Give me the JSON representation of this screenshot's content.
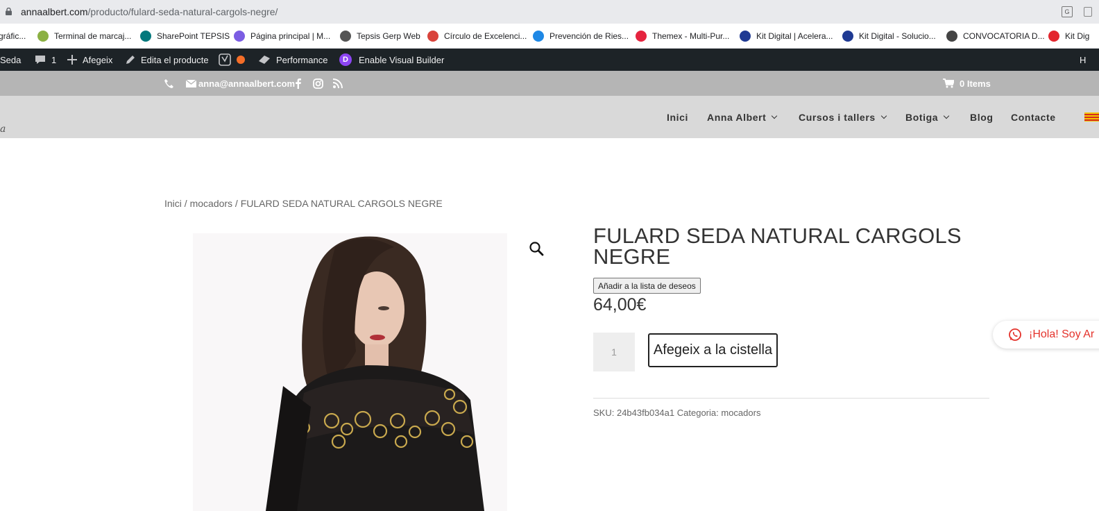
{
  "browser": {
    "url_domain": "annaalbert.com",
    "url_path": "/producto/fulard-seda-natural-cargols-negre/"
  },
  "bookmarks": [
    {
      "label": "gráfic...",
      "color": "#5b8a3a",
      "icon": "bookmark-icon"
    },
    {
      "label": "Terminal de marcaj...",
      "color": "#8bb043",
      "icon": "clock-globe-icon"
    },
    {
      "label": "SharePoint TEPSIS",
      "color": "#03787c",
      "icon": "sharepoint-icon"
    },
    {
      "label": "Página principal | M...",
      "color": "#7b5de3",
      "icon": "microsoft-icon"
    },
    {
      "label": "Tepsis Gerp Web",
      "color": "#555555",
      "icon": "globe-icon"
    },
    {
      "label": "Círculo de Excelenci...",
      "color": "#d9433b",
      "icon": "circle-logo-icon"
    },
    {
      "label": "Prevención de Ries...",
      "color": "#1e88e5",
      "icon": "arc-logo-icon"
    },
    {
      "label": "Themex - Multi-Pur...",
      "color": "#e5243f",
      "icon": "themex-icon"
    },
    {
      "label": "Kit Digital | Acelera...",
      "color": "#1f3a93",
      "icon": "kit-digital-icon"
    },
    {
      "label": "Kit Digital - Solucio...",
      "color": "#1f3a93",
      "icon": "kit-digital-icon"
    },
    {
      "label": "CONVOCATORIA D...",
      "color": "#444444",
      "icon": "text-logo-icon"
    },
    {
      "label": "Kit Dig",
      "color": "#e3262e",
      "icon": "kd-logo-icon"
    }
  ],
  "adminbar": {
    "site_name": "Seda",
    "comments_count": "1",
    "new_label": "Afegeix",
    "edit_label": "Edita el producte",
    "performance_label": "Performance",
    "visual_builder_label": "Enable Visual Builder",
    "divi_letter": "D",
    "right_fragment": "H"
  },
  "topbar": {
    "email": "anna@annaalbert.com",
    "cart_label": "0 Items"
  },
  "nav": {
    "items": [
      {
        "label": "Inici",
        "dropdown": false
      },
      {
        "label": "Anna Albert",
        "dropdown": true
      },
      {
        "label": "Cursos i tallers",
        "dropdown": true
      },
      {
        "label": "Botiga",
        "dropdown": true
      },
      {
        "label": "Blog",
        "dropdown": false
      },
      {
        "label": "Contacte",
        "dropdown": false
      }
    ],
    "logo_fragment": "a"
  },
  "breadcrumb": {
    "home": "Inici",
    "sep1": " / ",
    "category": "mocadors",
    "sep2": " / ",
    "current": "FULARD SEDA NATURAL CARGOLS NEGRE"
  },
  "product": {
    "title": "FULARD SEDA NATURAL CARGOLS NEGRE",
    "wishlist_label": "Añadir a la lista de deseos",
    "price": "64,00€",
    "quantity": "1",
    "add_to_cart_label": "Afegeix a la cistella",
    "sku_label": "SKU:",
    "sku_value": "24b43fb034a1",
    "category_label": "Categoria:",
    "category_value": "mocadors"
  },
  "whatsapp": {
    "label": "¡Hola! Soy Ar"
  }
}
